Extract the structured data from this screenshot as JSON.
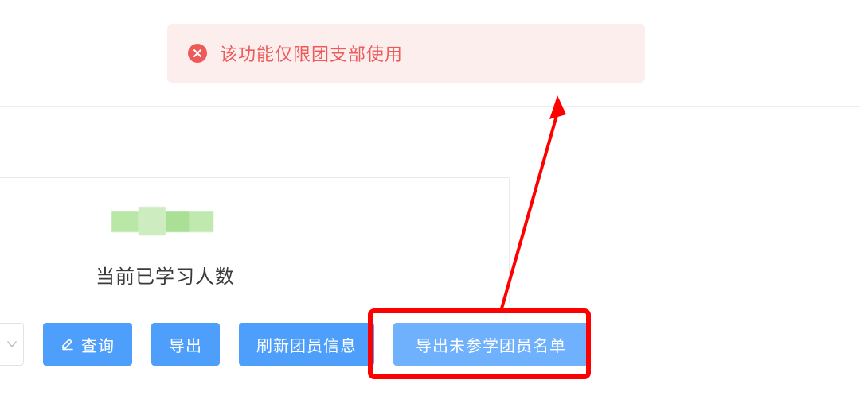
{
  "error": {
    "text": "该功能仅限团支部使用"
  },
  "card": {
    "label": "当前已学习人数"
  },
  "buttons": {
    "query": "查询",
    "export": "导出",
    "refresh_members": "刷新团员信息",
    "export_nonlearners": "导出未参学团员名单"
  }
}
